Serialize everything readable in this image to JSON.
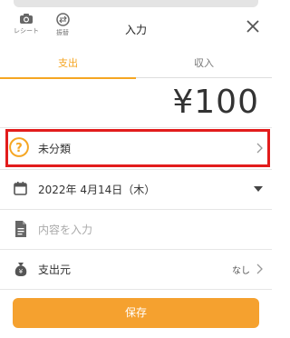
{
  "header": {
    "receipt_label": "レシート",
    "transfer_label": "振替",
    "title": "入力"
  },
  "tabs": [
    {
      "label": "支出",
      "active": true
    },
    {
      "label": "収入",
      "active": false
    }
  ],
  "amount": "¥100",
  "category": {
    "label": "未分類",
    "icon": "question-circle-icon"
  },
  "date": {
    "label": "2022年 4月14日（木）",
    "icon": "calendar-icon"
  },
  "memo": {
    "placeholder": "内容を入力",
    "icon": "document-icon"
  },
  "source": {
    "label": "支出元",
    "value": "なし",
    "icon": "money-bag-icon"
  },
  "save_label": "保存",
  "colors": {
    "accent": "#f5a623",
    "highlight": "#e21c1c",
    "button": "#f5a12f"
  }
}
